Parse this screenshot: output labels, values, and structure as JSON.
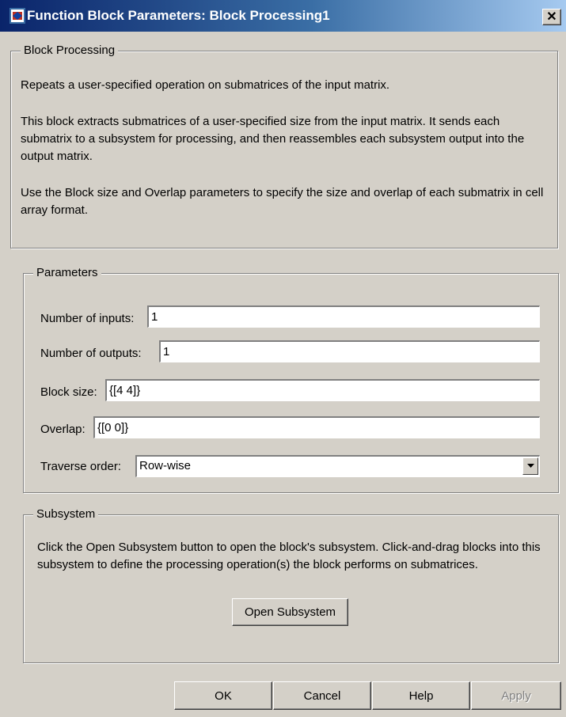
{
  "window": {
    "title": "Function Block Parameters: Block Processing1",
    "close_glyph": "✕"
  },
  "description": {
    "legend": "Block Processing",
    "paragraphs": [
      "Repeats a user-specified operation on submatrices of the input matrix.",
      "This block extracts submatrices of a user-specified size from the input matrix. It sends each submatrix to a subsystem for processing, and then reassembles each subsystem output into the output matrix.",
      "Use the Block size and Overlap parameters to specify the size and overlap of each submatrix in cell array format."
    ]
  },
  "parameters": {
    "legend": "Parameters",
    "number_of_inputs": {
      "label": "Number of inputs:",
      "value": "1"
    },
    "number_of_outputs": {
      "label": "Number of outputs:",
      "value": "1"
    },
    "block_size": {
      "label": "Block size:",
      "value": "{[4 4]}"
    },
    "overlap": {
      "label": "Overlap:",
      "value": "{[0 0]}"
    },
    "traverse_order": {
      "label": "Traverse order:",
      "value": "Row-wise"
    }
  },
  "subsystem": {
    "legend": "Subsystem",
    "text": "Click the Open Subsystem button to open the block's subsystem. Click-and-drag blocks into this subsystem to define the processing operation(s) the block performs on submatrices.",
    "open_button": "Open Subsystem"
  },
  "buttons": {
    "ok": "OK",
    "cancel": "Cancel",
    "help": "Help",
    "apply": "Apply"
  },
  "colors": {
    "title_bar_start": "#0a246a",
    "title_bar_end": "#a6caf0",
    "dialog_face": "#d4d0c8"
  }
}
